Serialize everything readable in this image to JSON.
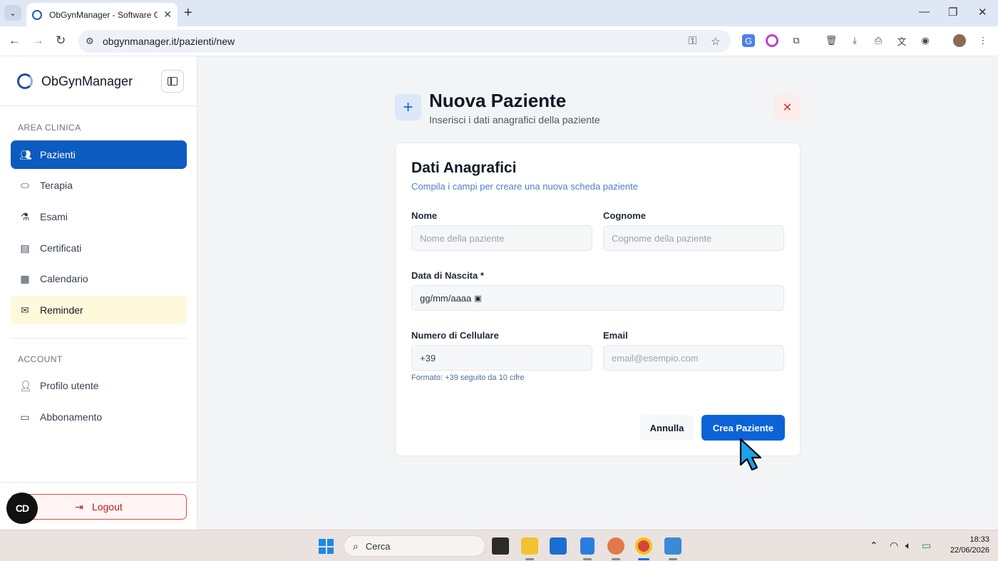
{
  "browser": {
    "tab_title": "ObGynManager - Software Ges",
    "url": "obgynmanager.it/pazienti/new"
  },
  "sidebar": {
    "brand": "ObGynManager",
    "section_clinic": "AREA CLINICA",
    "items": [
      {
        "label": "Pazienti",
        "icon": "users-icon"
      },
      {
        "label": "Terapia",
        "icon": "pill-icon"
      },
      {
        "label": "Esami",
        "icon": "flask-icon"
      },
      {
        "label": "Certificati",
        "icon": "document-icon"
      },
      {
        "label": "Calendario",
        "icon": "calendar-icon"
      },
      {
        "label": "Reminder",
        "icon": "mail-icon"
      }
    ],
    "section_account": "ACCOUNT",
    "account_items": [
      {
        "label": "Profilo utente",
        "icon": "user-icon"
      },
      {
        "label": "Abbonamento",
        "icon": "credit-card-icon"
      }
    ],
    "logout": "Logout"
  },
  "page": {
    "title": "Nuova Paziente",
    "subtitle": "Inserisci i dati anagrafici della paziente"
  },
  "form": {
    "title": "Dati Anagrafici",
    "subtitle": "Compila i campi per creare una nuova scheda paziente",
    "nome_label": "Nome",
    "nome_placeholder": "Nome della paziente",
    "cognome_label": "Cognome",
    "cognome_placeholder": "Cognome della paziente",
    "nascita_label": "Data di Nascita *",
    "nascita_value": "gg/mm/aaaa",
    "cellulare_label": "Numero di Cellulare",
    "cellulare_value": "+39",
    "email_label": "Email",
    "email_placeholder": "email@esempio.com",
    "hint": "Formato: +39 seguito da 10 cifre",
    "cancel": "Annulla",
    "submit": "Crea Paziente"
  },
  "taskbar": {
    "search": "Cerca",
    "time": "18:33",
    "date": "22/06/2026"
  },
  "colors": {
    "primary": "#0b5bc0",
    "button": "#0b63d6",
    "highlight": "#fef9db",
    "danger": "#dc2626"
  }
}
